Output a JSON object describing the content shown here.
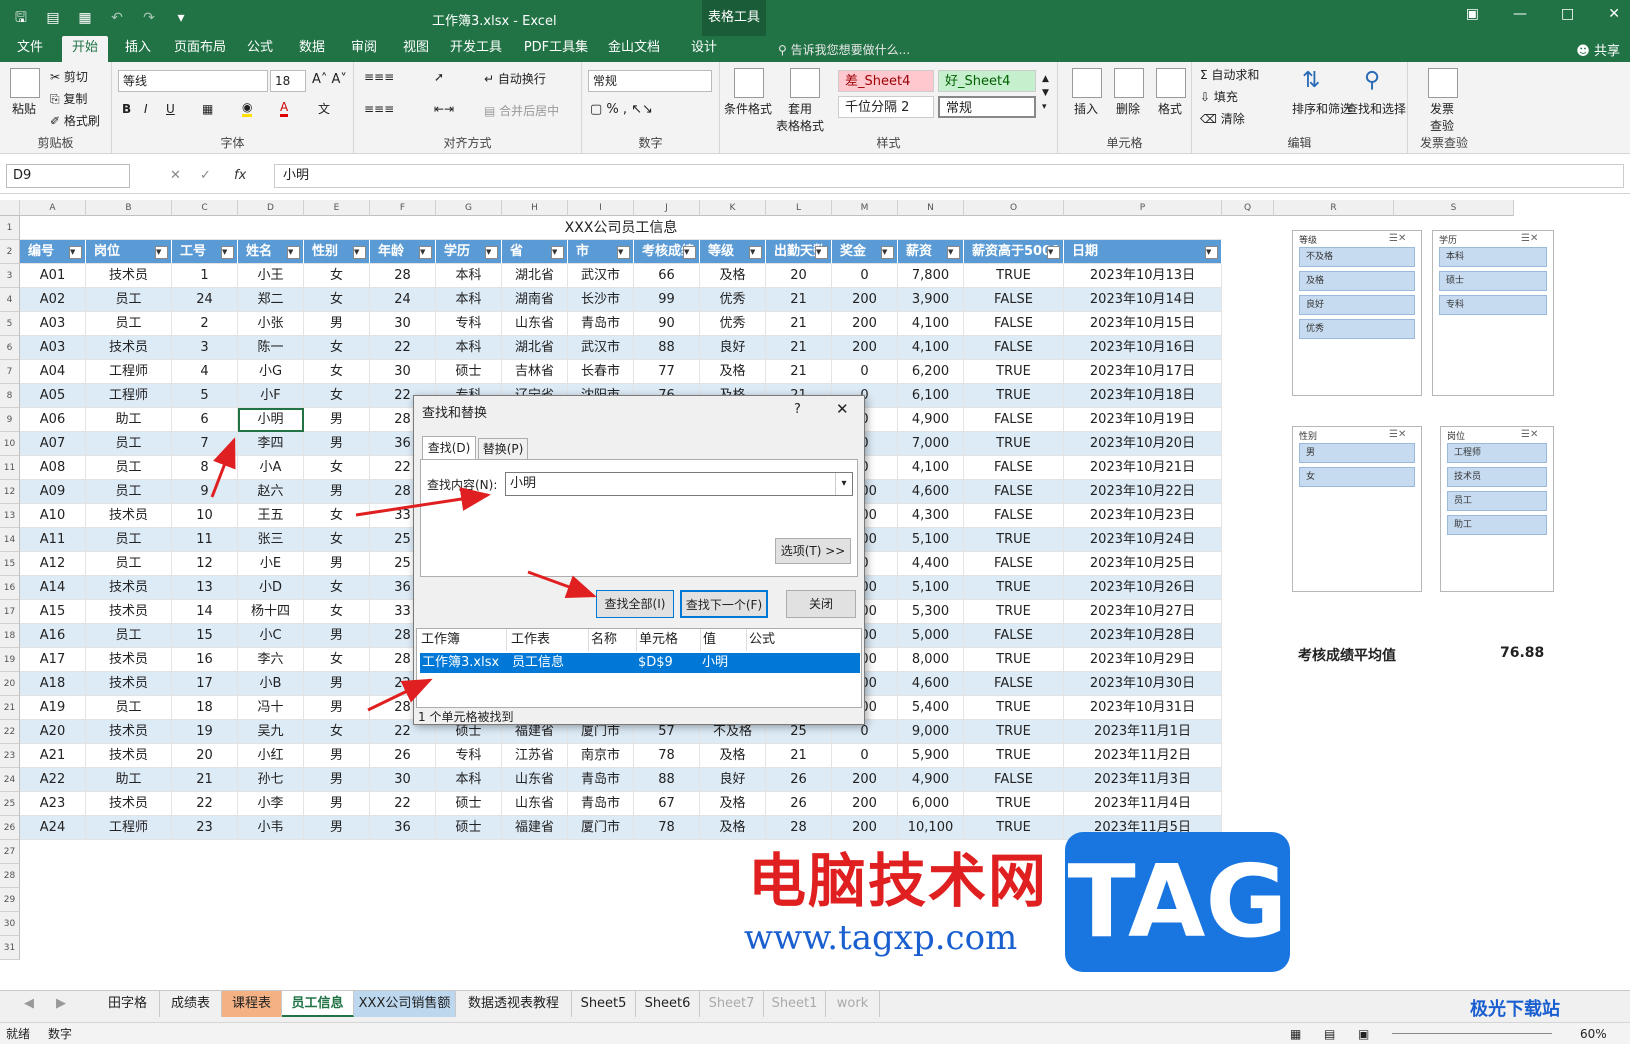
{
  "title": {
    "doc": "工作簿3.xlsx - Excel",
    "context_tab": "表格工具",
    "share": "共享",
    "tellme": "告诉我您想要做什么..."
  },
  "tabs": [
    "文件",
    "开始",
    "插入",
    "页面布局",
    "公式",
    "数据",
    "审阅",
    "视图",
    "开发工具",
    "PDF工具集",
    "金山文档",
    "设计"
  ],
  "ribbon": {
    "clipboard": {
      "paste": "粘贴",
      "cut": "剪切",
      "copy": "复制",
      "painter": "格式刷",
      "label": "剪贴板"
    },
    "font": {
      "name": "等线",
      "size": "18",
      "label": "字体",
      "bold": "B",
      "italic": "I",
      "underline": "U"
    },
    "align": {
      "wrap": "自动换行",
      "merge": "合并后居中",
      "label": "对齐方式"
    },
    "number": {
      "format": "常规",
      "label": "数字"
    },
    "styles": {
      "cond": "条件格式",
      "table": "套用\n表格格式",
      "bad": "差_Sheet4",
      "good": "好_Sheet4",
      "comma": "千位分隔 2",
      "normal": "常规",
      "label": "样式"
    },
    "cells": {
      "insert": "插入",
      "delete": "删除",
      "format": "格式",
      "label": "单元格"
    },
    "edit": {
      "autosum": "自动求和",
      "fill": "填充",
      "clear": "清除",
      "sort": "排序和筛选",
      "find": "查找和选择",
      "label": "编辑"
    },
    "invoice": {
      "btn": "发票\n查验",
      "label": "发票查验"
    }
  },
  "formula_bar": {
    "namebox": "D9",
    "value": "小明",
    "fx": "fx"
  },
  "columns": [
    "A",
    "B",
    "C",
    "D",
    "E",
    "F",
    "G",
    "H",
    "I",
    "J",
    "K",
    "L",
    "M",
    "N",
    "O",
    "P",
    "Q",
    "R",
    "S"
  ],
  "sheet_title": "XXX公司员工信息",
  "headers": [
    "编号",
    "岗位",
    "工号",
    "姓名",
    "性别",
    "年龄",
    "学历",
    "省",
    "市",
    "考核成绩",
    "等级",
    "出勤天数",
    "奖金",
    "薪资",
    "薪资高于5000",
    "日期"
  ],
  "rows": [
    [
      "A01",
      "技术员",
      "1",
      "小王",
      "女",
      "28",
      "本科",
      "湖北省",
      "武汉市",
      "66",
      "及格",
      "20",
      "0",
      "7,800",
      "TRUE",
      "2023年10月13日"
    ],
    [
      "A02",
      "员工",
      "24",
      "郑二",
      "女",
      "24",
      "本科",
      "湖南省",
      "长沙市",
      "99",
      "优秀",
      "21",
      "200",
      "3,900",
      "FALSE",
      "2023年10月14日"
    ],
    [
      "A03",
      "员工",
      "2",
      "小张",
      "男",
      "30",
      "专科",
      "山东省",
      "青岛市",
      "90",
      "优秀",
      "21",
      "200",
      "4,100",
      "FALSE",
      "2023年10月15日"
    ],
    [
      "A03",
      "技术员",
      "3",
      "陈一",
      "女",
      "22",
      "本科",
      "湖北省",
      "武汉市",
      "88",
      "良好",
      "21",
      "200",
      "4,100",
      "FALSE",
      "2023年10月16日"
    ],
    [
      "A04",
      "工程师",
      "4",
      "小G",
      "女",
      "30",
      "硕士",
      "吉林省",
      "长春市",
      "77",
      "及格",
      "21",
      "0",
      "6,200",
      "TRUE",
      "2023年10月17日"
    ],
    [
      "A05",
      "工程师",
      "5",
      "小F",
      "女",
      "22",
      "专科",
      "辽宁省",
      "沈阳市",
      "76",
      "及格",
      "21",
      "0",
      "6,100",
      "TRUE",
      "2023年10月18日"
    ],
    [
      "A06",
      "助工",
      "6",
      "小明",
      "男",
      "28",
      "",
      "",
      "",
      "",
      "",
      "",
      "0",
      "4,900",
      "FALSE",
      "2023年10月19日"
    ],
    [
      "A07",
      "员工",
      "7",
      "李四",
      "男",
      "36",
      "",
      "",
      "",
      "",
      "",
      "",
      "0",
      "7,000",
      "TRUE",
      "2023年10月20日"
    ],
    [
      "A08",
      "员工",
      "8",
      "小A",
      "女",
      "22",
      "",
      "",
      "",
      "",
      "",
      "",
      "0",
      "4,100",
      "FALSE",
      "2023年10月21日"
    ],
    [
      "A09",
      "员工",
      "9",
      "赵六",
      "男",
      "28",
      "",
      "",
      "",
      "",
      "",
      "",
      "200",
      "4,600",
      "FALSE",
      "2023年10月22日"
    ],
    [
      "A10",
      "技术员",
      "10",
      "王五",
      "女",
      "33",
      "",
      "",
      "",
      "",
      "",
      "",
      "200",
      "4,300",
      "FALSE",
      "2023年10月23日"
    ],
    [
      "A11",
      "员工",
      "11",
      "张三",
      "女",
      "25",
      "",
      "",
      "",
      "",
      "",
      "",
      "200",
      "5,100",
      "TRUE",
      "2023年10月24日"
    ],
    [
      "A12",
      "员工",
      "12",
      "小E",
      "男",
      "25",
      "",
      "",
      "",
      "",
      "",
      "",
      "0",
      "4,400",
      "FALSE",
      "2023年10月25日"
    ],
    [
      "A14",
      "技术员",
      "13",
      "小D",
      "女",
      "36",
      "",
      "",
      "",
      "",
      "",
      "",
      "200",
      "5,100",
      "TRUE",
      "2023年10月26日"
    ],
    [
      "A15",
      "技术员",
      "14",
      "杨十四",
      "女",
      "33",
      "",
      "",
      "",
      "",
      "",
      "",
      "200",
      "5,300",
      "TRUE",
      "2023年10月27日"
    ],
    [
      "A16",
      "员工",
      "15",
      "小C",
      "男",
      "28",
      "",
      "",
      "",
      "",
      "",
      "",
      "200",
      "5,000",
      "FALSE",
      "2023年10月28日"
    ],
    [
      "A17",
      "技术员",
      "16",
      "李六",
      "女",
      "28",
      "",
      "",
      "",
      "",
      "",
      "",
      "200",
      "8,000",
      "TRUE",
      "2023年10月29日"
    ],
    [
      "A18",
      "技术员",
      "17",
      "小B",
      "男",
      "22",
      "",
      "",
      "",
      "",
      "",
      "",
      "200",
      "4,600",
      "FALSE",
      "2023年10月30日"
    ],
    [
      "A19",
      "员工",
      "18",
      "冯十",
      "男",
      "28",
      "",
      "",
      "",
      "",
      "",
      "",
      "200",
      "5,400",
      "TRUE",
      "2023年10月31日"
    ],
    [
      "A20",
      "技术员",
      "19",
      "吴九",
      "女",
      "22",
      "硕士",
      "福建省",
      "厦门市",
      "57",
      "不及格",
      "25",
      "0",
      "9,000",
      "TRUE",
      "2023年11月1日"
    ],
    [
      "A21",
      "技术员",
      "20",
      "小红",
      "男",
      "26",
      "专科",
      "江苏省",
      "南京市",
      "78",
      "及格",
      "21",
      "0",
      "5,900",
      "TRUE",
      "2023年11月2日"
    ],
    [
      "A22",
      "助工",
      "21",
      "孙七",
      "男",
      "30",
      "本科",
      "山东省",
      "青岛市",
      "88",
      "良好",
      "26",
      "200",
      "4,900",
      "FALSE",
      "2023年11月3日"
    ],
    [
      "A23",
      "技术员",
      "22",
      "小李",
      "男",
      "22",
      "硕士",
      "山东省",
      "青岛市",
      "67",
      "及格",
      "26",
      "200",
      "6,000",
      "TRUE",
      "2023年11月4日"
    ],
    [
      "A24",
      "工程师",
      "23",
      "小韦",
      "男",
      "36",
      "硕士",
      "福建省",
      "厦门市",
      "78",
      "及格",
      "28",
      "200",
      "10,100",
      "TRUE",
      "2023年11月5日"
    ]
  ],
  "slicers": [
    {
      "title": "等级",
      "items": [
        "不及格",
        "及格",
        "良好",
        "优秀"
      ]
    },
    {
      "title": "学历",
      "items": [
        "本科",
        "硕士",
        "专科"
      ]
    },
    {
      "title": "性别",
      "items": [
        "男",
        "女"
      ]
    },
    {
      "title": "岗位",
      "items": [
        "工程师",
        "技术员",
        "员工",
        "助工"
      ]
    }
  ],
  "summary": {
    "label": "考核成绩平均值",
    "value": "76.88"
  },
  "dialog": {
    "title": "查找和替换",
    "help": "?",
    "close": "✕",
    "tab_find": "查找(D)",
    "tab_replace": "替换(P)",
    "find_label": "查找内容(N):",
    "find_value": "小明",
    "options": "选项(T) >>",
    "find_all": "查找全部(I)",
    "find_next": "查找下一个(F)",
    "close_btn": "关闭",
    "result_headers": [
      "工作簿",
      "工作表",
      "名称",
      "单元格",
      "值",
      "公式"
    ],
    "result_row": [
      "工作簿3.xlsx",
      "员工信息",
      "",
      "$D$9",
      "小明",
      ""
    ],
    "status": "1 个单元格被找到"
  },
  "sheet_tabs": [
    "田字格",
    "成绩表",
    "课程表",
    "员工信息",
    "XXX公司销售额",
    "数据透视表教程",
    "Sheet5",
    "Sheet6",
    "Sheet7",
    "Sheet1",
    "work"
  ],
  "status": {
    "ready": "就绪",
    "num": "数字",
    "zoom": "60%"
  },
  "watermark": {
    "cn": "电脑技术网",
    "url": "www.tagxp.com",
    "tag": "TAG",
    "dl": "极光下载站"
  }
}
